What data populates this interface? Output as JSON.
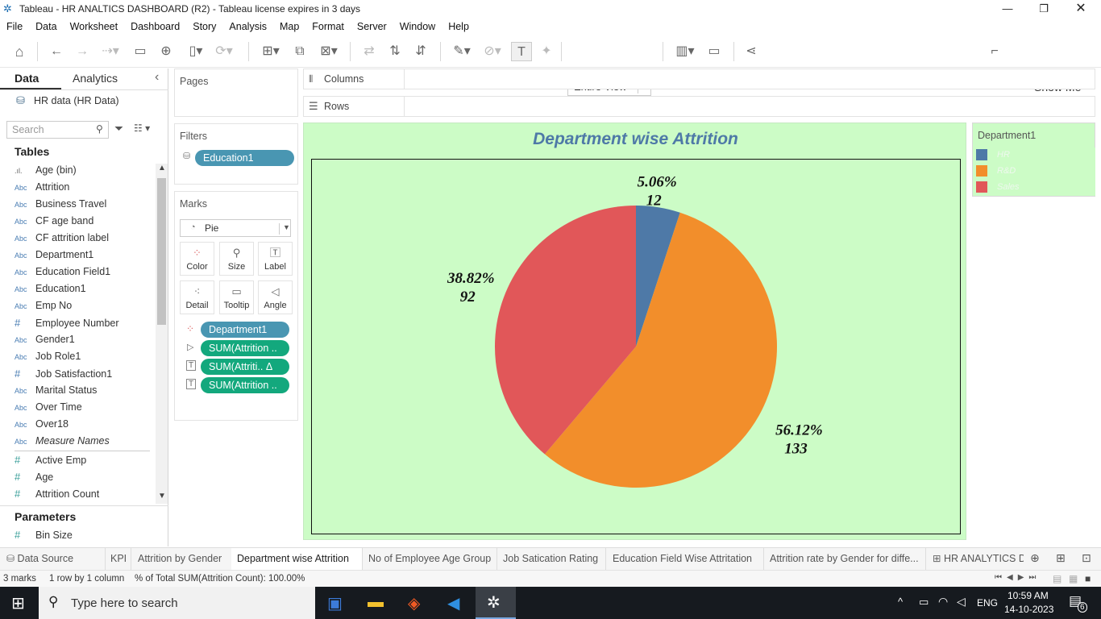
{
  "window": {
    "title": "Tableau - HR ANALTICS DASHBOARD (R2) - Tableau license expires in 3 days"
  },
  "menu": [
    "File",
    "Data",
    "Worksheet",
    "Dashboard",
    "Story",
    "Analysis",
    "Map",
    "Format",
    "Server",
    "Window",
    "Help"
  ],
  "toolbar": {
    "fit_value": "Entire View",
    "show_me": "Show Me"
  },
  "left_pane": {
    "tab_data": "Data",
    "tab_analytics": "Analytics",
    "datasource": "HR data (HR Data)",
    "search_placeholder": "Search",
    "tables_header": "Tables",
    "fields": [
      {
        "type": "bin",
        "name": "Age (bin)"
      },
      {
        "type": "Abc",
        "name": "Attrition"
      },
      {
        "type": "Abc",
        "name": "Business Travel"
      },
      {
        "type": "Abc",
        "name": "CF age band"
      },
      {
        "type": "Abc",
        "name": "CF attrition label"
      },
      {
        "type": "Abc",
        "name": "Department1"
      },
      {
        "type": "Abc",
        "name": "Education Field1"
      },
      {
        "type": "Abc",
        "name": "Education1"
      },
      {
        "type": "Abc",
        "name": "Emp No"
      },
      {
        "type": "#",
        "name": "Employee Number"
      },
      {
        "type": "Abc",
        "name": "Gender1"
      },
      {
        "type": "Abc",
        "name": "Job Role1"
      },
      {
        "type": "#",
        "name": "Job Satisfaction1"
      },
      {
        "type": "Abc",
        "name": "Marital Status"
      },
      {
        "type": "Abc",
        "name": "Over Time"
      },
      {
        "type": "Abc",
        "name": "Over18"
      },
      {
        "type": "Abc",
        "name": "Measure Names"
      },
      {
        "type": "#",
        "name": "Active Emp"
      },
      {
        "type": "#",
        "name": "Age"
      },
      {
        "type": "#",
        "name": "Attrition Count"
      }
    ],
    "parameters_header": "Parameters",
    "parameters": [
      {
        "type": "#",
        "name": "Bin Size"
      }
    ]
  },
  "shelves": {
    "pages": "Pages",
    "filters": "Filters",
    "filter_pill": "Education1",
    "marks": "Marks",
    "mark_type": "Pie",
    "mark_buttons": [
      "Color",
      "Size",
      "Label",
      "Detail",
      "Tooltip",
      "Angle"
    ],
    "mark_pills": [
      "Department1",
      "SUM(Attrition ..",
      "SUM(Attriti.. Δ",
      "SUM(Attrition .."
    ],
    "columns": "Columns",
    "rows": "Rows"
  },
  "legend": {
    "title": "Department1"
  },
  "chart_data": {
    "type": "pie",
    "title": "Department wise Attrition",
    "slices": [
      {
        "label": "HR",
        "value": 12,
        "percent": "5.06%",
        "color": "#4e79a7"
      },
      {
        "label": "R&D",
        "value": 133,
        "percent": "56.12%",
        "color": "#f28e2b"
      },
      {
        "label": "Sales",
        "value": 92,
        "percent": "38.82%",
        "color": "#e15759"
      }
    ]
  },
  "sheet_tabs": [
    "Data Source",
    "KPI",
    "Attrition by Gender",
    "Department wise Attrition",
    "No of Employee Age Group",
    "Job Satication Rating",
    "Education Field Wise Attritation",
    "Attrition rate by Gender for diffe...",
    "HR ANALYTICS D"
  ],
  "status": {
    "marks": "3 marks",
    "dims": "1 row by 1 column",
    "total": "% of Total SUM(Attrition Count): 100.00%"
  },
  "taskbar": {
    "search": "Type here to search",
    "lang": "ENG",
    "time": "10:59 AM",
    "date": "14-10-2023",
    "notif": "6"
  }
}
